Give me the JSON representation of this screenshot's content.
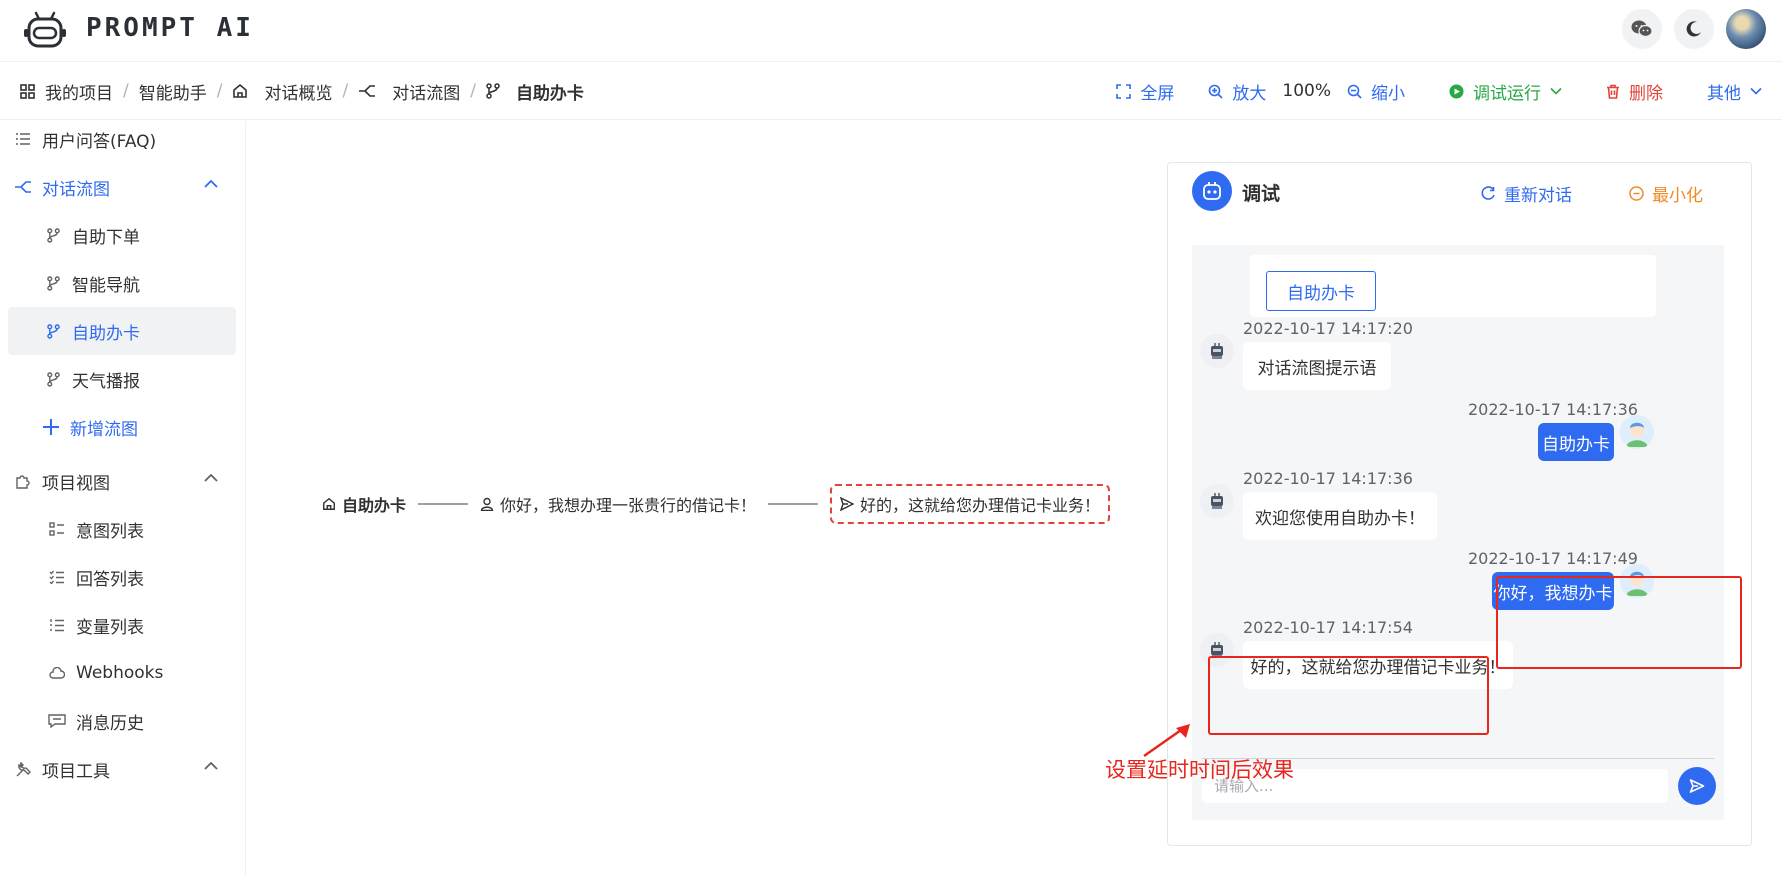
{
  "app": {
    "name": "PROMPT  AI"
  },
  "breadcrumb": [
    {
      "label": "我的项目"
    },
    {
      "label": "智能助手"
    },
    {
      "label": "对话概览"
    },
    {
      "label": "对话流图"
    },
    {
      "label": "自助办卡"
    }
  ],
  "toolbar": {
    "fullscreen": "全屏",
    "zoom_in": "放大",
    "zoom_level": "100%",
    "zoom_out": "缩小",
    "debug_run": "调试运行",
    "delete": "删除",
    "other": "其他"
  },
  "sidebar": {
    "faq": "用户问答(FAQ)",
    "flow_group": "对话流图",
    "flows": [
      "自助下单",
      "智能导航",
      "自助办卡",
      "天气播报"
    ],
    "add_flow": "新增流图",
    "view_group": "项目视图",
    "views": [
      "意图列表",
      "回答列表",
      "变量列表",
      "Webhooks",
      "消息历史"
    ],
    "tools_group": "项目工具"
  },
  "flow": {
    "start": "自助办卡",
    "user": "你好，我想办理一张贵行的借记卡！",
    "reply": "好的，这就给您办理借记卡业务！"
  },
  "debug": {
    "title": "调试",
    "restart": "重新对话",
    "minimize": "最小化",
    "card_button": "自助办卡",
    "messages": [
      {
        "time": "2022-10-17 14:17:20",
        "text": "对话流图提示语"
      },
      {
        "time": "2022-10-17 14:17:36",
        "text": "自助办卡"
      },
      {
        "time": "2022-10-17 14:17:36",
        "text": "欢迎您使用自助办卡！"
      },
      {
        "time": "2022-10-17 14:17:49",
        "text": "你好，我想办卡"
      },
      {
        "time": "2022-10-17 14:17:54",
        "text": "好的，这就给您办理借记卡业务！"
      }
    ],
    "input_placeholder": "请输入..."
  },
  "annotation": "设置延时时间后效果",
  "colors": {
    "primary": "#2f6bf0",
    "success": "#27a844",
    "danger": "#e2443a",
    "warning": "#f08a24",
    "highlight": "#e8261e"
  }
}
